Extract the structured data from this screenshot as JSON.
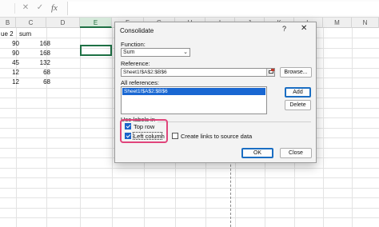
{
  "formula_bar": {
    "cancel_icon": "✕",
    "enter_icon": "✓",
    "fx_label": "fx",
    "formula_value": ""
  },
  "columns": [
    "B",
    "C",
    "D",
    "E",
    "F",
    "G",
    "H",
    "I",
    "J",
    "K",
    "L",
    "M",
    "N"
  ],
  "selected_column": "E",
  "sheet": {
    "header_row": [
      "ue 2",
      "sum"
    ],
    "rows": [
      [
        "90",
        "168"
      ],
      [
        "90",
        "168"
      ],
      [
        "45",
        "132"
      ],
      [
        "12",
        "68"
      ],
      [
        "12",
        "68"
      ]
    ]
  },
  "dialog": {
    "title": "Consolidate",
    "help": "?",
    "close": "✕",
    "function_label": "Function:",
    "function_value": "Sum",
    "reference_label": "Reference:",
    "reference_value": "Sheet1!$A$2:$B$6",
    "browse_label": "Browse...",
    "all_references_label": "All references:",
    "all_references": [
      "Sheet1!$A$2:$B$6"
    ],
    "add_label": "Add",
    "delete_label": "Delete",
    "use_labels_label": "Use labels in",
    "top_row_label": "Top row",
    "top_row_checked": true,
    "left_column_label": "Left column",
    "left_column_checked": true,
    "create_links_label": "Create links to source data",
    "create_links_checked": false,
    "ok_label": "OK",
    "close_label": "Close"
  },
  "colors": {
    "accent": "#1e7145",
    "highlight": "#e0457b",
    "selection": "#1967d2"
  }
}
